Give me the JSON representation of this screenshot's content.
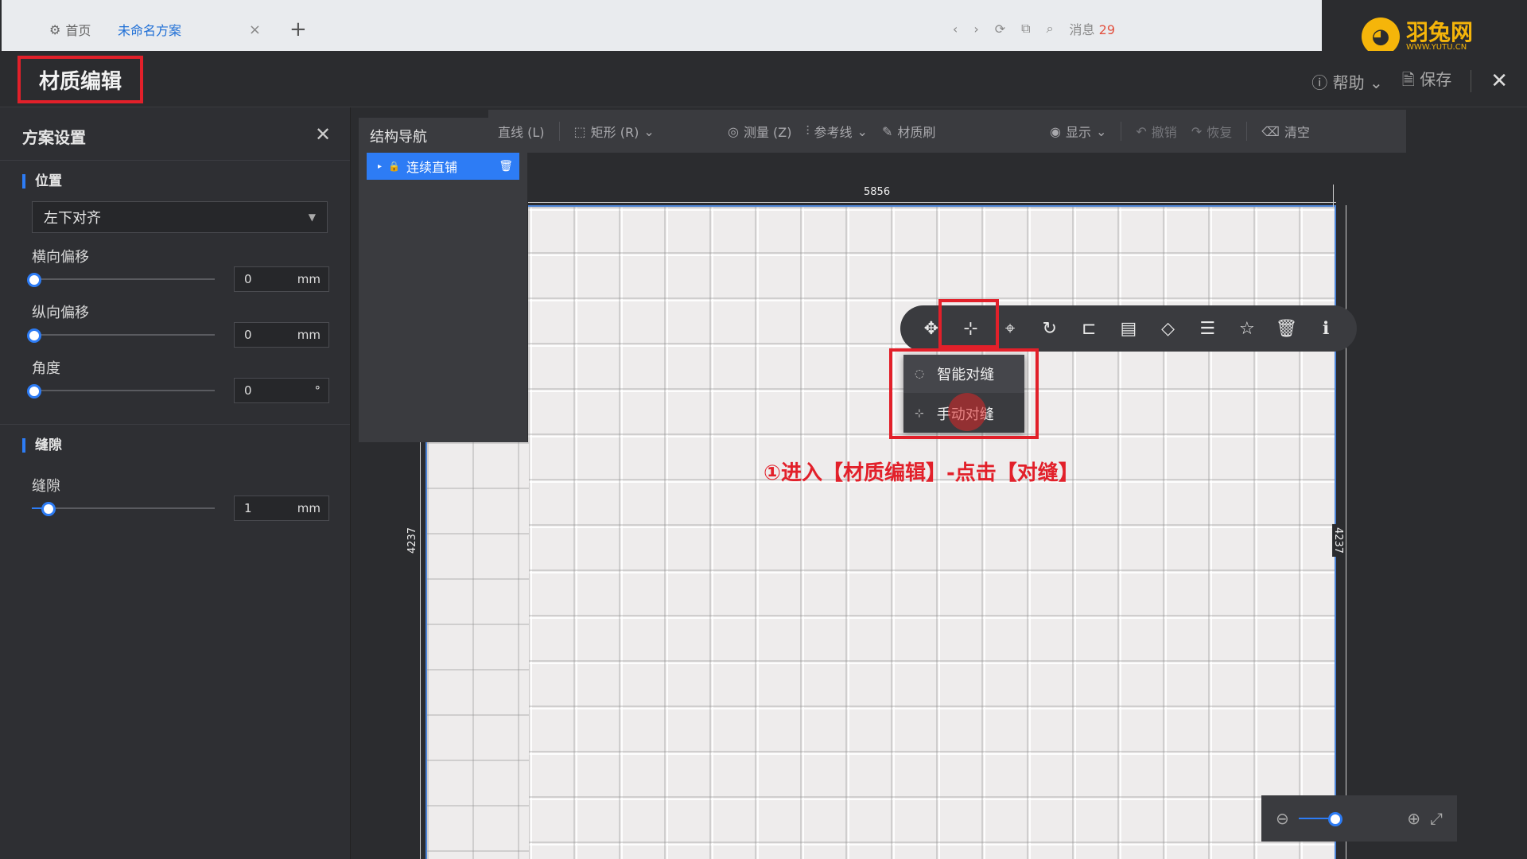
{
  "browser": {
    "tab_home": "首页",
    "tab_doc": "未命名方案",
    "tab_close": "×",
    "tab_add": "+",
    "nav": [
      "‹",
      "›",
      "⟳",
      "⧉",
      "⌕"
    ],
    "messages_label": "消息",
    "messages_count": "29"
  },
  "logo": {
    "name": "羽兔网",
    "url": "WWW.YUTU.CN"
  },
  "header": {
    "title": "材质编辑",
    "help": "帮助",
    "save": "保存",
    "close": "✕"
  },
  "left_panel": {
    "title": "方案设置",
    "position_section": "位置",
    "align_value": "左下对齐",
    "h_offset_label": "横向偏移",
    "h_offset_value": "0",
    "v_offset_label": "纵向偏移",
    "v_offset_value": "0",
    "angle_label": "角度",
    "angle_value": "0",
    "gap_section": "缝隙",
    "gap_label": "缝隙",
    "gap_value": "1",
    "unit_mm": "mm",
    "unit_deg": "°",
    "sliders": {
      "h_offset": 0,
      "v_offset": 0,
      "angle": 0,
      "gap": 0.08
    }
  },
  "struct_nav": {
    "title": "结构导航",
    "item": "连续直铺"
  },
  "toolbar": {
    "line": "直线 (L)",
    "rect": "矩形 (R)",
    "measure": "测量 (Z)",
    "refline": "参考线",
    "brush": "材质刷",
    "display": "显示",
    "undo": "撤销",
    "redo": "恢复",
    "clear": "清空"
  },
  "dimensions": {
    "top": "5856",
    "left": "4237",
    "right": "4237"
  },
  "menu": {
    "smart": "智能对缝",
    "manual": "手动对缝"
  },
  "annotation": "①进入【材质编辑】-点击【对缝】",
  "zoom": {
    "level": 0.35
  },
  "colors": {
    "accent": "#2d7cf5",
    "highlight": "#e2202a",
    "logo": "#f5b50a"
  }
}
